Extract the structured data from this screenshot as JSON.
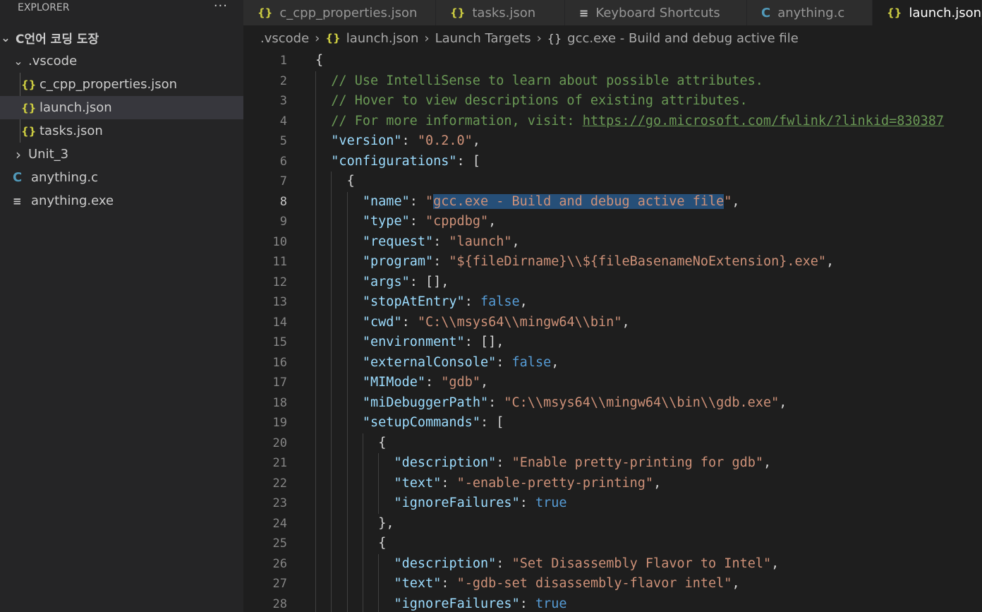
{
  "sidebar": {
    "title": "EXPLORER",
    "more": "···",
    "items": [
      {
        "label": "C언어 코딩 도장",
        "type": "folder",
        "expanded": true,
        "indent": 0
      },
      {
        "label": ".vscode",
        "type": "folder",
        "expanded": true,
        "indent": 1
      },
      {
        "label": "c_cpp_properties.json",
        "type": "json",
        "indent": 2
      },
      {
        "label": "launch.json",
        "type": "json",
        "indent": 2,
        "selected": true
      },
      {
        "label": "tasks.json",
        "type": "json",
        "indent": 2
      },
      {
        "label": "Unit_3",
        "type": "folder",
        "expanded": false,
        "indent": 1
      },
      {
        "label": "anything.c",
        "type": "c",
        "indent": 1
      },
      {
        "label": "anything.exe",
        "type": "exe",
        "indent": 1
      }
    ]
  },
  "tabs": [
    {
      "label": "c_cpp_properties.json",
      "icon": "json-icon",
      "active": false
    },
    {
      "label": "tasks.json",
      "icon": "json-icon",
      "active": false
    },
    {
      "label": "Keyboard Shortcuts",
      "icon": "keyboard-shortcuts-icon",
      "active": false
    },
    {
      "label": "anything.c",
      "icon": "c-file-icon",
      "active": false
    },
    {
      "label": "launch.json",
      "icon": "json-icon",
      "active": true
    }
  ],
  "breadcrumb": {
    "folder": ".vscode",
    "file": "launch.json",
    "section": "Launch Targets",
    "item": "gcc.exe - Build and debug active file"
  },
  "editor": {
    "current_line": 8,
    "lines": [
      {
        "n": "1",
        "indent": 0,
        "tokens": [
          [
            "p",
            "{"
          ]
        ]
      },
      {
        "n": "2",
        "indent": 1,
        "tokens": [
          [
            "c",
            "// Use IntelliSense to learn about possible attributes."
          ]
        ]
      },
      {
        "n": "3",
        "indent": 1,
        "tokens": [
          [
            "c",
            "// Hover to view descriptions of existing attributes."
          ]
        ]
      },
      {
        "n": "4",
        "indent": 1,
        "tokens": [
          [
            "c",
            "// For more information, visit: "
          ],
          [
            "u",
            "https://go.microsoft.com/fwlink/?linkid=830387"
          ]
        ]
      },
      {
        "n": "5",
        "indent": 1,
        "tokens": [
          [
            "k",
            "\"version\""
          ],
          [
            "p",
            ": "
          ],
          [
            "s",
            "\"0.2.0\""
          ],
          [
            "p",
            ","
          ]
        ]
      },
      {
        "n": "6",
        "indent": 1,
        "tokens": [
          [
            "k",
            "\"configurations\""
          ],
          [
            "p",
            ": ["
          ]
        ]
      },
      {
        "n": "7",
        "indent": 2,
        "tokens": [
          [
            "p",
            "{"
          ]
        ]
      },
      {
        "n": "8",
        "indent": 3,
        "tokens": [
          [
            "k",
            "\"name\""
          ],
          [
            "p",
            ": "
          ],
          [
            "s",
            "\""
          ],
          [
            "sel",
            "gcc.exe - Build and debug active file"
          ],
          [
            "s",
            "\""
          ],
          [
            "p",
            ","
          ]
        ]
      },
      {
        "n": "9",
        "indent": 3,
        "tokens": [
          [
            "k",
            "\"type\""
          ],
          [
            "p",
            ": "
          ],
          [
            "s",
            "\"cppdbg\""
          ],
          [
            "p",
            ","
          ]
        ]
      },
      {
        "n": "10",
        "indent": 3,
        "tokens": [
          [
            "k",
            "\"request\""
          ],
          [
            "p",
            ": "
          ],
          [
            "s",
            "\"launch\""
          ],
          [
            "p",
            ","
          ]
        ]
      },
      {
        "n": "11",
        "indent": 3,
        "tokens": [
          [
            "k",
            "\"program\""
          ],
          [
            "p",
            ": "
          ],
          [
            "s",
            "\"${fileDirname}\\\\${fileBasenameNoExtension}.exe\""
          ],
          [
            "p",
            ","
          ]
        ]
      },
      {
        "n": "12",
        "indent": 3,
        "tokens": [
          [
            "k",
            "\"args\""
          ],
          [
            "p",
            ": [],"
          ]
        ]
      },
      {
        "n": "13",
        "indent": 3,
        "tokens": [
          [
            "k",
            "\"stopAtEntry\""
          ],
          [
            "p",
            ": "
          ],
          [
            "b",
            "false"
          ],
          [
            "p",
            ","
          ]
        ]
      },
      {
        "n": "14",
        "indent": 3,
        "tokens": [
          [
            "k",
            "\"cwd\""
          ],
          [
            "p",
            ": "
          ],
          [
            "s",
            "\"C:\\\\msys64\\\\mingw64\\\\bin\""
          ],
          [
            "p",
            ","
          ]
        ]
      },
      {
        "n": "15",
        "indent": 3,
        "tokens": [
          [
            "k",
            "\"environment\""
          ],
          [
            "p",
            ": [],"
          ]
        ]
      },
      {
        "n": "16",
        "indent": 3,
        "tokens": [
          [
            "k",
            "\"externalConsole\""
          ],
          [
            "p",
            ": "
          ],
          [
            "b",
            "false"
          ],
          [
            "p",
            ","
          ]
        ]
      },
      {
        "n": "17",
        "indent": 3,
        "tokens": [
          [
            "k",
            "\"MIMode\""
          ],
          [
            "p",
            ": "
          ],
          [
            "s",
            "\"gdb\""
          ],
          [
            "p",
            ","
          ]
        ]
      },
      {
        "n": "18",
        "indent": 3,
        "tokens": [
          [
            "k",
            "\"miDebuggerPath\""
          ],
          [
            "p",
            ": "
          ],
          [
            "s",
            "\"C:\\\\msys64\\\\mingw64\\\\bin\\\\gdb.exe\""
          ],
          [
            "p",
            ","
          ]
        ]
      },
      {
        "n": "19",
        "indent": 3,
        "tokens": [
          [
            "k",
            "\"setupCommands\""
          ],
          [
            "p",
            ": ["
          ]
        ]
      },
      {
        "n": "20",
        "indent": 4,
        "tokens": [
          [
            "p",
            "{"
          ]
        ]
      },
      {
        "n": "21",
        "indent": 5,
        "tokens": [
          [
            "k",
            "\"description\""
          ],
          [
            "p",
            ": "
          ],
          [
            "s",
            "\"Enable pretty-printing for gdb\""
          ],
          [
            "p",
            ","
          ]
        ]
      },
      {
        "n": "22",
        "indent": 5,
        "tokens": [
          [
            "k",
            "\"text\""
          ],
          [
            "p",
            ": "
          ],
          [
            "s",
            "\"-enable-pretty-printing\""
          ],
          [
            "p",
            ","
          ]
        ]
      },
      {
        "n": "23",
        "indent": 5,
        "tokens": [
          [
            "k",
            "\"ignoreFailures\""
          ],
          [
            "p",
            ": "
          ],
          [
            "b",
            "true"
          ]
        ]
      },
      {
        "n": "24",
        "indent": 4,
        "tokens": [
          [
            "p",
            "},"
          ]
        ]
      },
      {
        "n": "25",
        "indent": 4,
        "tokens": [
          [
            "p",
            "{"
          ]
        ]
      },
      {
        "n": "26",
        "indent": 5,
        "tokens": [
          [
            "k",
            "\"description\""
          ],
          [
            "p",
            ": "
          ],
          [
            "s",
            "\"Set Disassembly Flavor to Intel\""
          ],
          [
            "p",
            ","
          ]
        ]
      },
      {
        "n": "27",
        "indent": 5,
        "tokens": [
          [
            "k",
            "\"text\""
          ],
          [
            "p",
            ": "
          ],
          [
            "s",
            "\"-gdb-set disassembly-flavor intel\""
          ],
          [
            "p",
            ","
          ]
        ]
      },
      {
        "n": "28",
        "indent": 5,
        "tokens": [
          [
            "k",
            "\"ignoreFailures\""
          ],
          [
            "p",
            ": "
          ],
          [
            "b",
            "true"
          ]
        ]
      }
    ]
  }
}
